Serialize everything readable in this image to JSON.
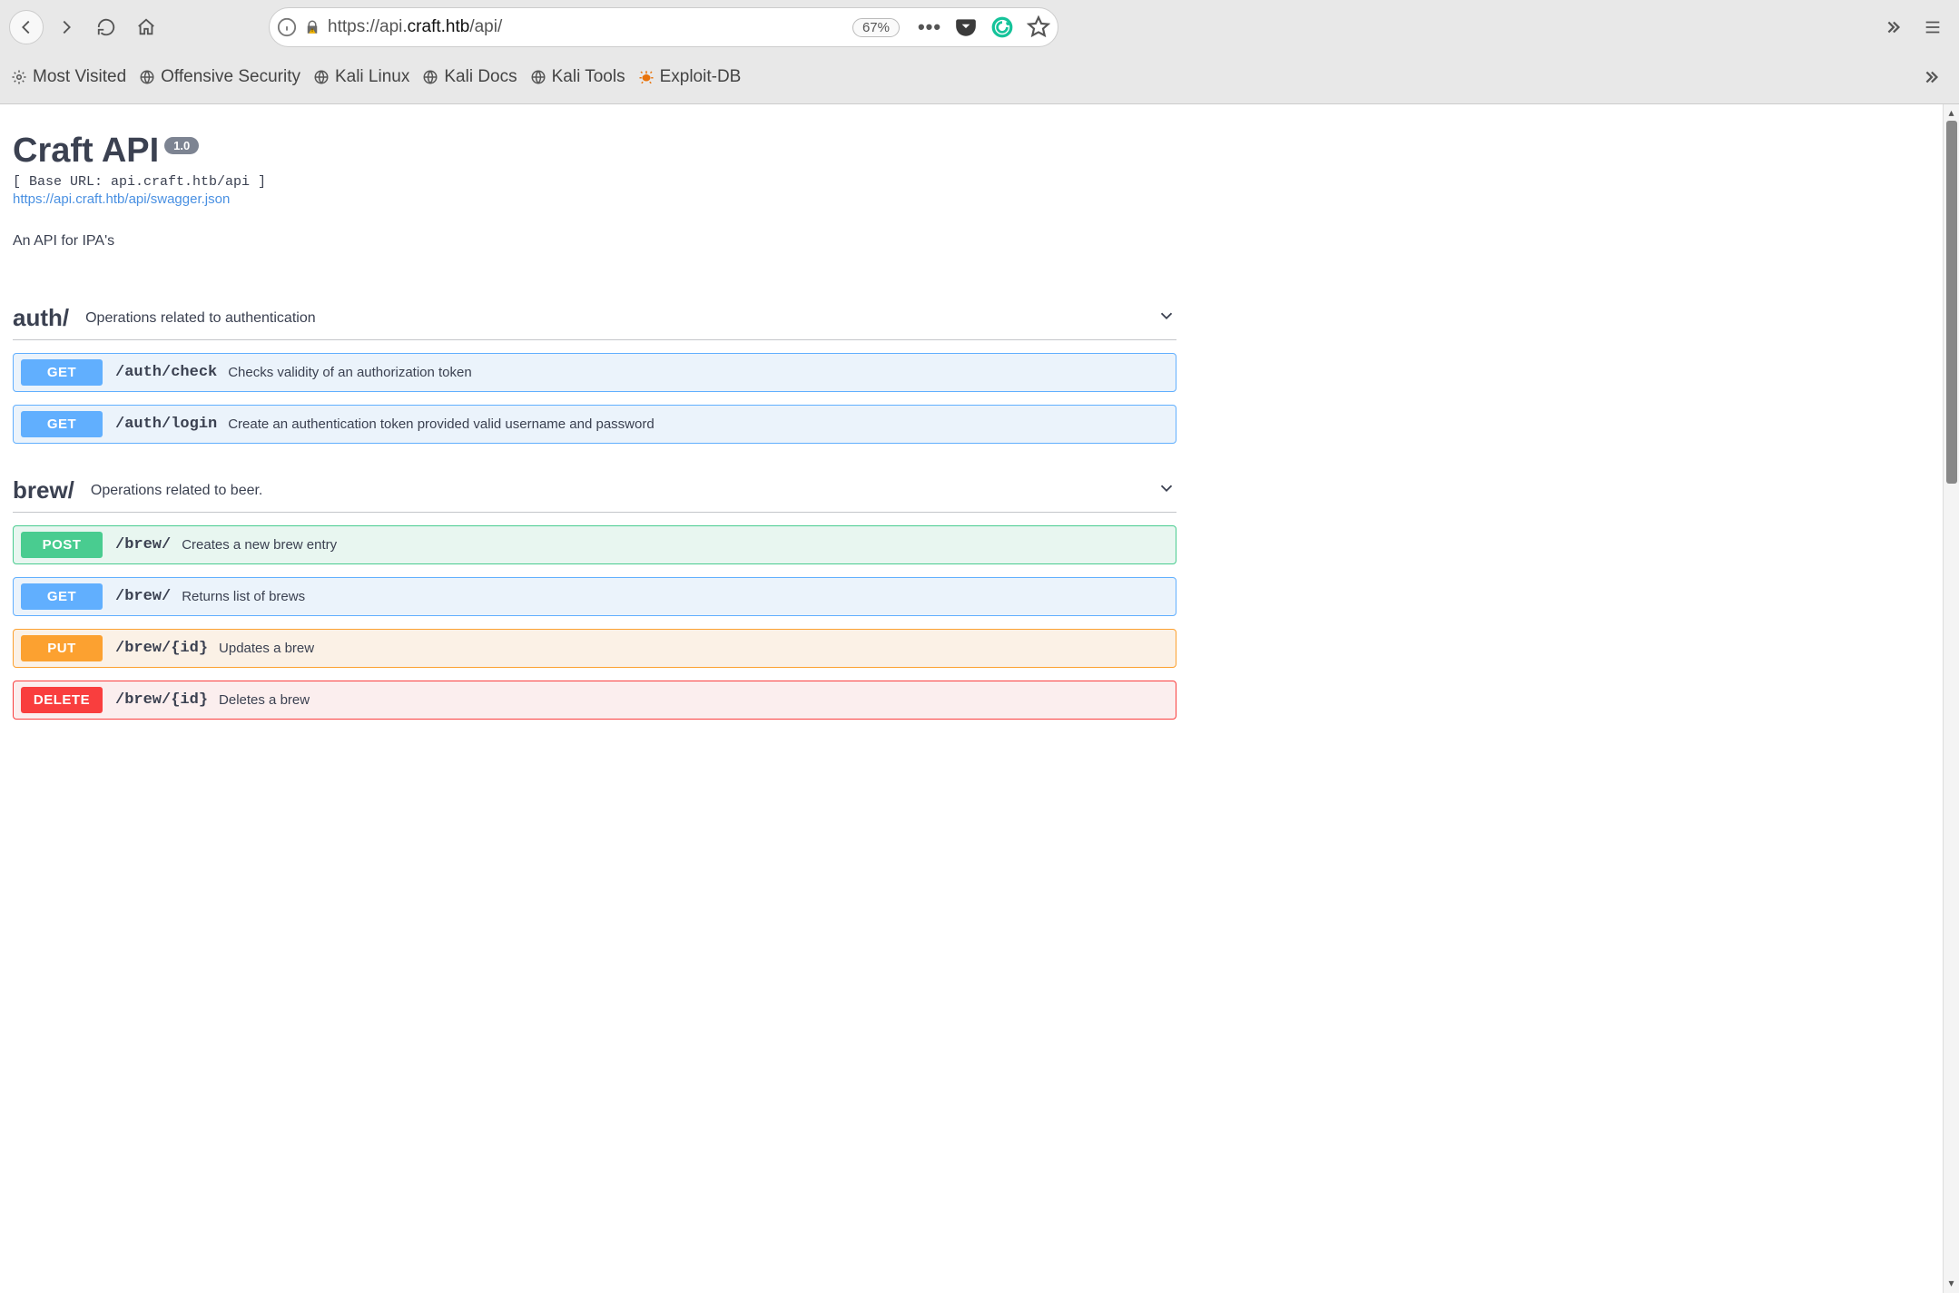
{
  "browser": {
    "url_proto": "https://",
    "url_host_pre": "api.",
    "url_host_strong": "craft.htb",
    "url_path": "/api/",
    "zoom": "67%"
  },
  "bookmarks": [
    {
      "label": "Most Visited",
      "icon": "gear"
    },
    {
      "label": "Offensive Security",
      "icon": "globe"
    },
    {
      "label": "Kali Linux",
      "icon": "globe"
    },
    {
      "label": "Kali Docs",
      "icon": "globe"
    },
    {
      "label": "Kali Tools",
      "icon": "globe"
    },
    {
      "label": "Exploit-DB",
      "icon": "bug"
    }
  ],
  "api": {
    "title": "Craft API",
    "version": "1.0",
    "base_url": "[ Base URL: api.craft.htb/api ]",
    "swagger_link": "https://api.craft.htb/api/swagger.json",
    "description": "An API for IPA's"
  },
  "sections": [
    {
      "name": "auth/",
      "description": "Operations related to authentication",
      "ops": [
        {
          "method": "GET",
          "path": "/auth/check",
          "summary": "Checks validity of an authorization token"
        },
        {
          "method": "GET",
          "path": "/auth/login",
          "summary": "Create an authentication token provided valid username and password"
        }
      ]
    },
    {
      "name": "brew/",
      "description": "Operations related to beer.",
      "ops": [
        {
          "method": "POST",
          "path": "/brew/",
          "summary": "Creates a new brew entry"
        },
        {
          "method": "GET",
          "path": "/brew/",
          "summary": "Returns list of brews"
        },
        {
          "method": "PUT",
          "path": "/brew/{id}",
          "summary": "Updates a brew"
        },
        {
          "method": "DELETE",
          "path": "/brew/{id}",
          "summary": "Deletes a brew"
        }
      ]
    }
  ]
}
